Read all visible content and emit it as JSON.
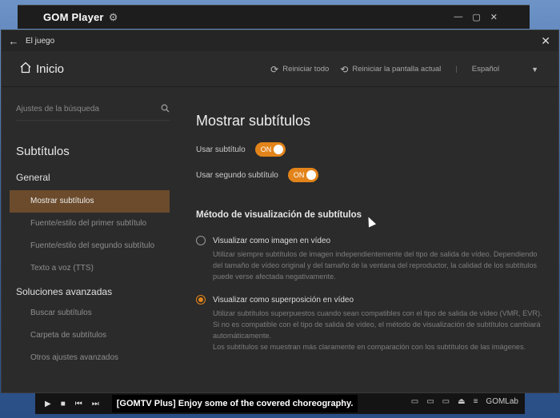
{
  "player": {
    "app_name": "GOM Player",
    "ticker": "[GOMTV Plus]  Enjoy some of the covered choreography.",
    "controls": [
      "▶",
      "■",
      "⏮",
      "⏭"
    ],
    "right_controls": [
      "▭",
      "▭",
      "▭",
      "⏏",
      "≡",
      "GOMLab"
    ]
  },
  "window": {
    "title": "El juego",
    "home": "Inicio",
    "actions": {
      "reset_all": "Reiniciar todo",
      "reset_screen": "Reiniciar la pantalla actual",
      "language": "Español"
    }
  },
  "sidebar": {
    "search_placeholder": "Ajustes de la búsqueda",
    "section": "Subtítulos",
    "group_general": "General",
    "general_items": [
      "Mostrar subtítulos",
      "Fuente/estilo del primer subtítulo",
      "Fuente/estilo del segundo subtítulo",
      "Texto a voz (TTS)"
    ],
    "group_advanced": "Soluciones avanzadas",
    "advanced_items": [
      "Buscar subtítulos",
      "Carpeta de subtítulos",
      "Otros ajustes avanzados"
    ]
  },
  "main": {
    "title": "Mostrar subtítulos",
    "use_subtitle": {
      "label": "Usar subtítulo",
      "state": "ON"
    },
    "use_second_subtitle": {
      "label": "Usar segundo subtítulo",
      "state": "ON"
    },
    "method_title": "Método de visualización de subtítulos",
    "option1": {
      "label": "Visualizar como imagen en vídeo",
      "desc": "Utilizar siempre subtítulos de imagen independientemente del tipo de salida de vídeo. Dependiendo del tamaño de vídeo original y del tamaño de la ventana del reproductor, la calidad de los subtítulos puede verse afectada negativamente."
    },
    "option2": {
      "label": "Visualizar como superposición en vídeo",
      "desc1": "Utilizar subtítulos superpuestos cuando sean compatibles con el tipo de salida de vídeo (VMR, EVR).",
      "desc2": "Si no es compatible con el tipo de salida de vídeo, el método de visualización de subtítulos cambiará automáticamente.",
      "desc3": "Los subtítulos se muestran más claramente en comparación con los subtítulos de las imágenes."
    }
  },
  "colors": {
    "accent": "#e2841a",
    "active_item": "#6b4b2c",
    "background": "#2b2b2b"
  }
}
